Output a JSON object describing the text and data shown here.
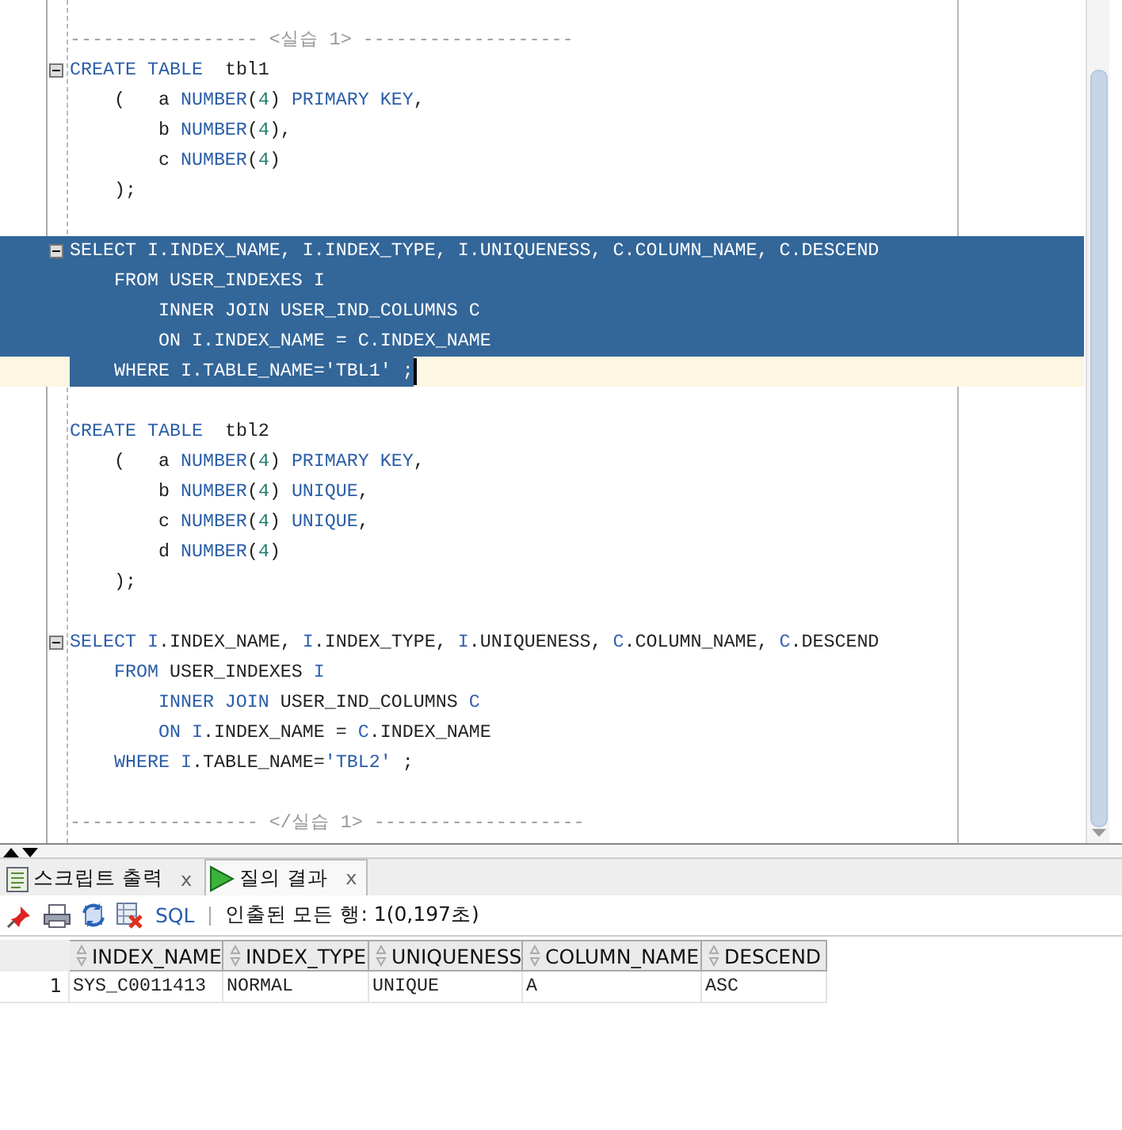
{
  "editor": {
    "lines": [
      {
        "selected": false,
        "current": false,
        "fold": false,
        "tokens": [
          {
            "text": "----------------- <실습 1> -------------------",
            "kind": "comment"
          }
        ]
      },
      {
        "selected": false,
        "current": false,
        "fold": true,
        "tokens": [
          {
            "text": "CREATE TABLE",
            "kind": "keyword"
          },
          {
            "text": "  tbl1",
            "kind": "plain"
          }
        ]
      },
      {
        "selected": false,
        "current": false,
        "fold": false,
        "tokens": [
          {
            "text": "    (   a ",
            "kind": "plain"
          },
          {
            "text": "NUMBER",
            "kind": "keyword"
          },
          {
            "text": "(",
            "kind": "plain"
          },
          {
            "text": "4",
            "kind": "number"
          },
          {
            "text": ") ",
            "kind": "plain"
          },
          {
            "text": "PRIMARY KEY",
            "kind": "keyword"
          },
          {
            "text": ",",
            "kind": "plain"
          }
        ]
      },
      {
        "selected": false,
        "current": false,
        "fold": false,
        "tokens": [
          {
            "text": "        b ",
            "kind": "plain"
          },
          {
            "text": "NUMBER",
            "kind": "keyword"
          },
          {
            "text": "(",
            "kind": "plain"
          },
          {
            "text": "4",
            "kind": "number"
          },
          {
            "text": "),",
            "kind": "plain"
          }
        ]
      },
      {
        "selected": false,
        "current": false,
        "fold": false,
        "tokens": [
          {
            "text": "        c ",
            "kind": "plain"
          },
          {
            "text": "NUMBER",
            "kind": "keyword"
          },
          {
            "text": "(",
            "kind": "plain"
          },
          {
            "text": "4",
            "kind": "number"
          },
          {
            "text": ")",
            "kind": "plain"
          }
        ]
      },
      {
        "selected": false,
        "current": false,
        "fold": false,
        "tokens": [
          {
            "text": "    );",
            "kind": "plain"
          }
        ]
      },
      {
        "selected": false,
        "current": false,
        "fold": false
      },
      {
        "selected": true,
        "current": false,
        "fold": true,
        "tokens": [
          {
            "text": "SELECT ",
            "kind": "keyword"
          },
          {
            "text": "I",
            "kind": "alias"
          },
          {
            "text": ".INDEX_NAME, ",
            "kind": "plain"
          },
          {
            "text": "I",
            "kind": "alias"
          },
          {
            "text": ".INDEX_TYPE, ",
            "kind": "plain"
          },
          {
            "text": "I",
            "kind": "alias"
          },
          {
            "text": ".UNIQUENESS, ",
            "kind": "plain"
          },
          {
            "text": "C",
            "kind": "alias"
          },
          {
            "text": ".COLUMN_NAME, ",
            "kind": "plain"
          },
          {
            "text": "C",
            "kind": "alias"
          },
          {
            "text": ".DESCEND",
            "kind": "plain"
          }
        ]
      },
      {
        "selected": true,
        "current": false,
        "fold": false,
        "tokens": [
          {
            "text": "    FROM",
            "kind": "keyword"
          },
          {
            "text": " USER_INDEXES ",
            "kind": "plain"
          },
          {
            "text": "I",
            "kind": "alias"
          }
        ]
      },
      {
        "selected": true,
        "current": false,
        "fold": false,
        "tokens": [
          {
            "text": "        INNER JOIN",
            "kind": "keyword"
          },
          {
            "text": " USER_IND_COLUMNS ",
            "kind": "plain"
          },
          {
            "text": "C",
            "kind": "alias"
          }
        ]
      },
      {
        "selected": true,
        "current": false,
        "fold": false,
        "tokens": [
          {
            "text": "        ON ",
            "kind": "keyword"
          },
          {
            "text": "I",
            "kind": "alias"
          },
          {
            "text": ".INDEX_NAME = ",
            "kind": "plain"
          },
          {
            "text": "C",
            "kind": "alias"
          },
          {
            "text": ".INDEX_NAME",
            "kind": "plain"
          }
        ]
      },
      {
        "selected": true,
        "current": true,
        "fold": false,
        "tokens": [
          {
            "text": "    WHERE ",
            "kind": "keyword"
          },
          {
            "text": "I",
            "kind": "alias"
          },
          {
            "text": ".TABLE_NAME=",
            "kind": "plain"
          },
          {
            "text": "'TBL1'",
            "kind": "string"
          },
          {
            "text": " ;",
            "kind": "plain"
          }
        ]
      },
      {
        "selected": false,
        "current": false,
        "fold": false
      },
      {
        "selected": false,
        "current": false,
        "fold": false,
        "tokens": [
          {
            "text": "CREATE TABLE",
            "kind": "keyword"
          },
          {
            "text": "  tbl2",
            "kind": "plain"
          }
        ]
      },
      {
        "selected": false,
        "current": false,
        "fold": false,
        "tokens": [
          {
            "text": "    (   a ",
            "kind": "plain"
          },
          {
            "text": "NUMBER",
            "kind": "keyword"
          },
          {
            "text": "(",
            "kind": "plain"
          },
          {
            "text": "4",
            "kind": "number"
          },
          {
            "text": ") ",
            "kind": "plain"
          },
          {
            "text": "PRIMARY KEY",
            "kind": "keyword"
          },
          {
            "text": ",",
            "kind": "plain"
          }
        ]
      },
      {
        "selected": false,
        "current": false,
        "fold": false,
        "tokens": [
          {
            "text": "        b ",
            "kind": "plain"
          },
          {
            "text": "NUMBER",
            "kind": "keyword"
          },
          {
            "text": "(",
            "kind": "plain"
          },
          {
            "text": "4",
            "kind": "number"
          },
          {
            "text": ") ",
            "kind": "plain"
          },
          {
            "text": "UNIQUE",
            "kind": "keyword"
          },
          {
            "text": ",",
            "kind": "plain"
          }
        ]
      },
      {
        "selected": false,
        "current": false,
        "fold": false,
        "tokens": [
          {
            "text": "        c ",
            "kind": "plain"
          },
          {
            "text": "NUMBER",
            "kind": "keyword"
          },
          {
            "text": "(",
            "kind": "plain"
          },
          {
            "text": "4",
            "kind": "number"
          },
          {
            "text": ") ",
            "kind": "plain"
          },
          {
            "text": "UNIQUE",
            "kind": "keyword"
          },
          {
            "text": ",",
            "kind": "plain"
          }
        ]
      },
      {
        "selected": false,
        "current": false,
        "fold": false,
        "tokens": [
          {
            "text": "        d ",
            "kind": "plain"
          },
          {
            "text": "NUMBER",
            "kind": "keyword"
          },
          {
            "text": "(",
            "kind": "plain"
          },
          {
            "text": "4",
            "kind": "number"
          },
          {
            "text": ")",
            "kind": "plain"
          }
        ]
      },
      {
        "selected": false,
        "current": false,
        "fold": false,
        "tokens": [
          {
            "text": "    );",
            "kind": "plain"
          }
        ]
      },
      {
        "selected": false,
        "current": false,
        "fold": false
      },
      {
        "selected": false,
        "current": false,
        "fold": true,
        "tokens": [
          {
            "text": "SELECT ",
            "kind": "keyword"
          },
          {
            "text": "I",
            "kind": "alias"
          },
          {
            "text": ".INDEX_NAME, ",
            "kind": "plain"
          },
          {
            "text": "I",
            "kind": "alias"
          },
          {
            "text": ".INDEX_TYPE, ",
            "kind": "plain"
          },
          {
            "text": "I",
            "kind": "alias"
          },
          {
            "text": ".UNIQUENESS, ",
            "kind": "plain"
          },
          {
            "text": "C",
            "kind": "alias"
          },
          {
            "text": ".COLUMN_NAME, ",
            "kind": "plain"
          },
          {
            "text": "C",
            "kind": "alias"
          },
          {
            "text": ".DESCEND",
            "kind": "plain"
          }
        ]
      },
      {
        "selected": false,
        "current": false,
        "fold": false,
        "tokens": [
          {
            "text": "    FROM",
            "kind": "keyword"
          },
          {
            "text": " USER_INDEXES ",
            "kind": "plain"
          },
          {
            "text": "I",
            "kind": "alias"
          }
        ]
      },
      {
        "selected": false,
        "current": false,
        "fold": false,
        "tokens": [
          {
            "text": "        INNER JOIN",
            "kind": "keyword"
          },
          {
            "text": " USER_IND_COLUMNS ",
            "kind": "plain"
          },
          {
            "text": "C",
            "kind": "alias"
          }
        ]
      },
      {
        "selected": false,
        "current": false,
        "fold": false,
        "tokens": [
          {
            "text": "        ON ",
            "kind": "keyword"
          },
          {
            "text": "I",
            "kind": "alias"
          },
          {
            "text": ".INDEX_NAME = ",
            "kind": "plain"
          },
          {
            "text": "C",
            "kind": "alias"
          },
          {
            "text": ".INDEX_NAME",
            "kind": "plain"
          }
        ]
      },
      {
        "selected": false,
        "current": false,
        "fold": false,
        "tokens": [
          {
            "text": "    WHERE ",
            "kind": "keyword"
          },
          {
            "text": "I",
            "kind": "alias"
          },
          {
            "text": ".TABLE_NAME=",
            "kind": "plain"
          },
          {
            "text": "'TBL2'",
            "kind": "string"
          },
          {
            "text": " ;",
            "kind": "plain"
          }
        ]
      },
      {
        "selected": false,
        "current": false,
        "fold": false
      },
      {
        "selected": false,
        "current": false,
        "fold": false,
        "tokens": [
          {
            "text": "----------------- </실습 1> -------------------",
            "kind": "comment"
          }
        ]
      }
    ]
  },
  "tabs": [
    {
      "label": "스크립트 출력",
      "kind": "script",
      "close": "x",
      "selected": false
    },
    {
      "label": "질의 결과",
      "kind": "query",
      "close": "x",
      "selected": true
    }
  ],
  "toolbar": {
    "sql": "SQL",
    "status": "인출된 모든 행: 1(0,197초)"
  },
  "table": {
    "columns": [
      "INDEX_NAME",
      "INDEX_TYPE",
      "UNIQUENESS",
      "COLUMN_NAME",
      "DESCEND"
    ],
    "rows": [
      {
        "number": "1",
        "cells": [
          "SYS_C0011413",
          "NORMAL",
          "UNIQUE",
          "A",
          "ASC"
        ]
      }
    ]
  }
}
